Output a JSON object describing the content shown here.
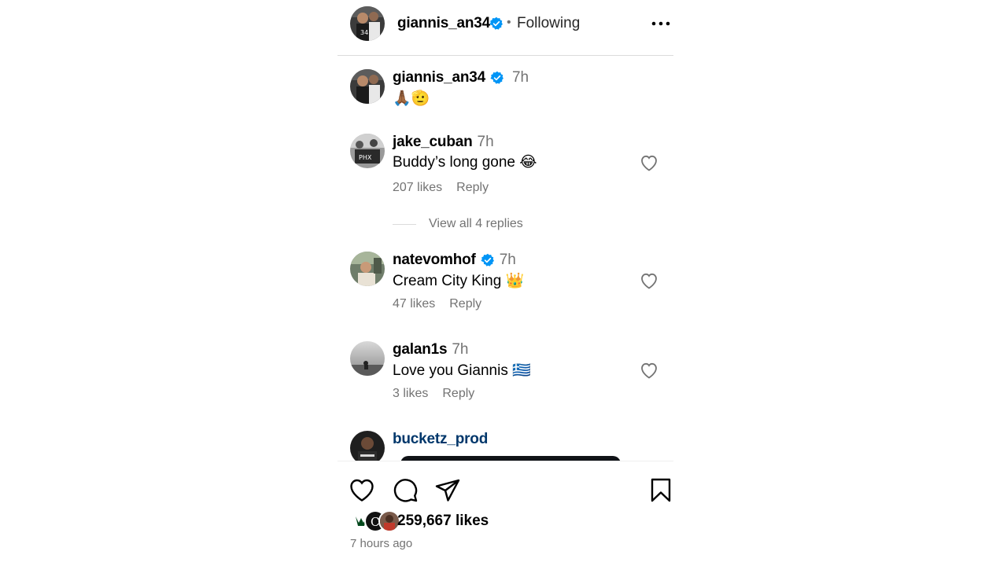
{
  "header": {
    "username": "giannis_an34",
    "separator": "•",
    "follow_status": "Following",
    "more_icon": "more-horizontal-icon"
  },
  "caption": {
    "username": "giannis_an34",
    "time": "7h",
    "text": "🙏🏾🫡"
  },
  "comments": [
    {
      "username": "jake_cuban",
      "time": "7h",
      "text": "Buddy’s long gone 😂",
      "likes": "207 likes",
      "reply": "Reply"
    },
    {
      "username": "natevomhof",
      "time": "7h",
      "text": "Cream City King 👑",
      "likes": "47 likes",
      "reply": "Reply"
    },
    {
      "username": "galan1s",
      "time": "7h",
      "text": "Love you Giannis 🇬🇷",
      "likes": "3 likes",
      "reply": "Reply"
    },
    {
      "username": "bucketz_prod"
    }
  ],
  "view_replies": "View all 4 replies",
  "footer": {
    "likes": "259,667 likes",
    "time_ago": "7 hours ago"
  },
  "colors": {
    "verified": "#0095f6",
    "secondary_text": "#737373",
    "link": "#00376b",
    "divider": "#dbdbdb"
  }
}
